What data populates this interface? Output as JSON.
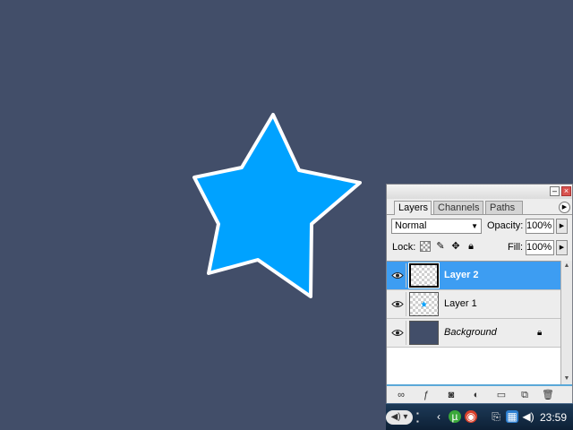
{
  "canvas": {
    "background_color": "#424e69",
    "shape": {
      "icon": "star-shape",
      "fill_color": "#00a2ff",
      "stroke_color": "#ffffff"
    }
  },
  "layers_panel": {
    "tabs": [
      {
        "label": "Layers",
        "active": true
      },
      {
        "label": "Channels",
        "active": false
      },
      {
        "label": "Paths",
        "active": false
      }
    ],
    "blend_mode": "Normal",
    "opacity_label": "Opacity:",
    "opacity_value": "100%",
    "lock_label": "Lock:",
    "fill_label": "Fill:",
    "fill_value": "100%",
    "selection_color": "#3d9df2",
    "layers": [
      {
        "name": "Layer 2",
        "visible": true,
        "selected": true,
        "thumbnail": "transparent"
      },
      {
        "name": "Layer 1",
        "visible": true,
        "selected": false,
        "thumbnail": "transparent-with-star"
      },
      {
        "name": "Background",
        "visible": true,
        "selected": false,
        "thumbnail": "solid",
        "locked": true
      }
    ],
    "footer_icons": [
      "link-icon",
      "layer-style-icon",
      "mask-icon",
      "adjustment-icon",
      "folder-icon",
      "new-layer-icon",
      "trash-icon"
    ]
  },
  "taskbar": {
    "clock": "23:59",
    "tray_icons": [
      "arrow-left-icon",
      "utorrent-icon",
      "antivirus-icon",
      "safely-remove-icon",
      "network-icon",
      "speaker-icon"
    ]
  }
}
